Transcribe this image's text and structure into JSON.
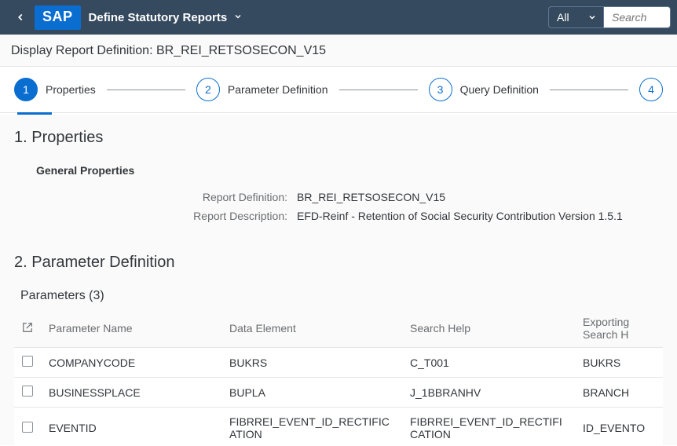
{
  "shell": {
    "logo_text": "SAP",
    "title": "Define Statutory Reports",
    "filter_label": "All",
    "search_placeholder": "Search"
  },
  "subheader": {
    "title": "Display Report Definition: BR_REI_RETSOSECON_V15"
  },
  "wizard": {
    "step1": {
      "num": "1",
      "label": "Properties"
    },
    "step2": {
      "num": "2",
      "label": "Parameter Definition"
    },
    "step3": {
      "num": "3",
      "label": "Query Definition"
    },
    "step4": {
      "num": "4"
    }
  },
  "properties": {
    "heading": "1. Properties",
    "general_heading": "General Properties",
    "definition_label": "Report Definition:",
    "definition_value": "BR_REI_RETSOSECON_V15",
    "description_label": "Report Description:",
    "description_value": "EFD-Reinf - Retention of Social Security Contribution Version 1.5.1"
  },
  "params": {
    "heading": "2. Parameter Definition",
    "table_heading": "Parameters (3)",
    "col_name": "Parameter Name",
    "col_data_element": "Data Element",
    "col_search_help": "Search Help",
    "col_exporting": "Exporting Search H",
    "rows": [
      {
        "name": "COMPANYCODE",
        "de": "BUKRS",
        "sh": "C_T001",
        "exp": "BUKRS"
      },
      {
        "name": "BUSINESSPLACE",
        "de": "BUPLA",
        "sh": "J_1BBRANHV",
        "exp": "BRANCH"
      },
      {
        "name": "EVENTID",
        "de": "FIBRREI_EVENT_ID_RECTIFICATION",
        "sh": "FIBRREI_EVENT_ID_RECTIFICATION",
        "exp": "ID_EVENTO"
      }
    ]
  }
}
